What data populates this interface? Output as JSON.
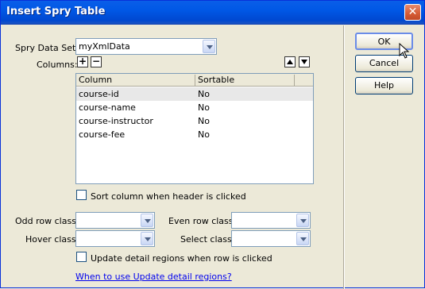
{
  "window": {
    "title": "Insert Spry Table",
    "close_glyph": "✕"
  },
  "form": {
    "data_set_label": "Spry Data Set:",
    "data_set_value": "myXmlData",
    "columns_label": "Columns:",
    "add_glyph": "+",
    "remove_glyph": "−"
  },
  "table": {
    "headers": [
      "Column",
      "Sortable"
    ],
    "rows": [
      {
        "column": "course-id",
        "sortable": "No"
      },
      {
        "column": "course-name",
        "sortable": "No"
      },
      {
        "column": "course-instructor",
        "sortable": "No"
      },
      {
        "column": "course-fee",
        "sortable": "No"
      }
    ]
  },
  "options": {
    "sort_checkbox_label": "Sort column when header is clicked",
    "odd_row_label": "Odd row class:",
    "even_row_label": "Even row class:",
    "hover_label": "Hover class:",
    "select_label": "Select class:",
    "odd_row_value": "",
    "even_row_value": "",
    "hover_value": "",
    "select_value": "",
    "update_checkbox_label": "Update detail regions when row is clicked",
    "help_link": "When to use Update detail regions?"
  },
  "buttons": {
    "ok": "OK",
    "cancel": "Cancel",
    "help": "Help"
  },
  "colors": {
    "titlebar": "#0058e6",
    "dialog": "#ece9d8",
    "link": "#0000ee"
  }
}
